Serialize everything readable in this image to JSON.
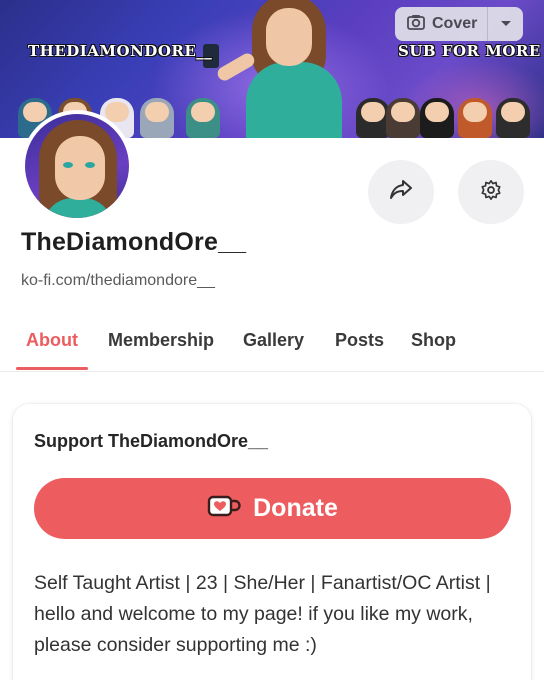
{
  "cover": {
    "left_text": "THEDIAMONDORE__",
    "right_text": "SUB FOR MORE",
    "button_label": "Cover",
    "button_icon": "camera-icon",
    "dropdown_icon": "caret-down-icon"
  },
  "profile": {
    "name": "TheDiamondOre__",
    "url": "ko-fi.com/thediamondore__"
  },
  "actions": {
    "share_icon": "share-icon",
    "settings_icon": "gear-icon"
  },
  "tabs": [
    {
      "label": "About",
      "active": true
    },
    {
      "label": "Membership",
      "active": false
    },
    {
      "label": "Gallery",
      "active": false
    },
    {
      "label": "Posts",
      "active": false
    },
    {
      "label": "Shop",
      "active": false
    }
  ],
  "support_card": {
    "title": "Support TheDiamondOre__",
    "donate_label": "Donate",
    "donate_icon": "ko-fi-cup-icon",
    "description": "Self Taught Artist | 23 | She/Her | Fanartist/OC Artist | hello and welcome to my page! if you like my work, please consider supporting me :)"
  },
  "colors": {
    "accent": "#ec5d5f",
    "donate_button": "#ed5d5f",
    "round_button_bg": "#f0f0f2"
  }
}
